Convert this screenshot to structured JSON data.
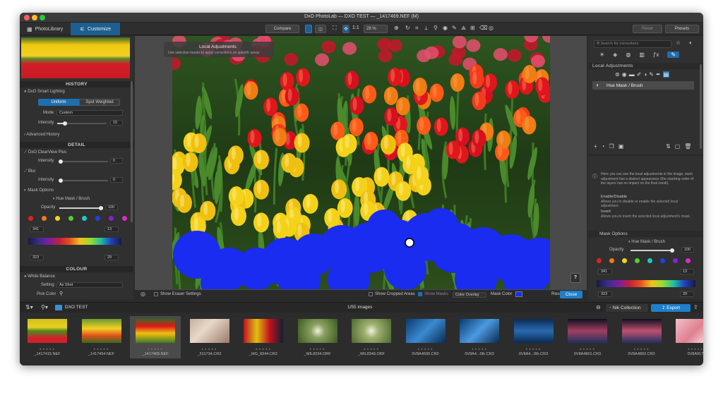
{
  "window": {
    "title": "DxO PhotoLab — DXO TEST — _1417469.NEF (M)"
  },
  "toolbar": {
    "tab_library": "PhotoLibrary",
    "tab_customize": "Customize",
    "compare_label": "Compare",
    "zoom_1to1": "1:1",
    "zoom_value": "28 %",
    "reset_label": "Reset",
    "presets_label": "Presets"
  },
  "left_panel": {
    "history_title": "HISTORY",
    "smart_lighting_label": "DxO Smart Lighting",
    "uniform_label": "Uniform",
    "spot_weighted_label": "Spot Weighted",
    "mode_label": "Mode",
    "mode_value": "Custom",
    "intensity_label": "Intensity",
    "intensity_value": "15",
    "advanced_history_label": "Advanced History",
    "detail_title": "DETAIL",
    "clearview_label": "DxO ClearView Plus",
    "clearview_intensity_label": "Intensity",
    "clearview_intensity_value": "0",
    "blur_label": "Blur",
    "blur_intensity_label": "Intensity",
    "blur_intensity_value": "0",
    "mask_options_label": "Mask Options",
    "hue_mask_label": "Hue Mask / Brush",
    "opacity_label": "Opacity",
    "opacity_value": "100",
    "hue_low": "341",
    "hue_high": "13",
    "hue_low2": "323",
    "hue_high2": "29",
    "colour_title": "COLOUR",
    "white_balance_label": "White Balance",
    "setting_label": "Setting",
    "setting_value": "As Shot",
    "pick_colour_label": "Pick Color"
  },
  "viewer": {
    "local_adjustments_banner": "Local Adjustments",
    "banner_hint": "Use selective masks to apply corrections on specific areas",
    "show_eraser_label": "Show Eraser Settings",
    "show_cropped_label": "Show Cropped Areas",
    "show_masks_label": "Show Masks",
    "color_overlay_value": "Color Overlay",
    "mask_color_label": "Mask Color",
    "reset_label": "Reset",
    "close_label": "Close",
    "help_label": "?"
  },
  "right_panel": {
    "search_placeholder": "Search for corrections",
    "local_adjustments_title": "Local Adjustments",
    "layer_name": "Hue Mask / Brush",
    "help_intro": "Here you can see the local adjustments in the image; each adjustment has a distinct appearance (the stacking order of the layers has no impact on the final result).",
    "enable_title": "Enable/Disable",
    "enable_text": "Allows you to disable or enable the selected local adjustment.",
    "invert_title": "Invert",
    "invert_text": "Allows you to invert the selected local adjustment's mask.",
    "mask_options_label": "Mask Options",
    "hue_mask_label": "Hue Mask / Brush",
    "opacity_label": "Opacity",
    "opacity_value": "100",
    "hue_low": "341",
    "hue_high": "13",
    "hue_low2": "323",
    "hue_high2": "29"
  },
  "filmstrip_bar": {
    "folder_name": "DXO TEST",
    "count_label": "1/55 images",
    "nik_label": "Nik Collection",
    "export_label": "Export"
  },
  "thumbnails": [
    {
      "name": "_1417415.NEF"
    },
    {
      "name": "_1417454.NEF"
    },
    {
      "name": "_1417469.NEF"
    },
    {
      "name": "_511734.CR3"
    },
    {
      "name": "_MG_8344.CR2"
    },
    {
      "name": "_WIL8334.ORF"
    },
    {
      "name": "_WIL8349.ORF"
    },
    {
      "name": "0V8A4590.CR3"
    },
    {
      "name": "0V8A4...0th.CR3"
    },
    {
      "name": "0V8A4...0th.CR3"
    },
    {
      "name": "0V8A4801.CR3"
    },
    {
      "name": "0V8A4802.CR3"
    },
    {
      "name": "0V8A917"
    }
  ],
  "colors": {
    "accent": "#1f7fc8",
    "mask_blue": "#1a2cf0",
    "panel_bg": "#303030"
  }
}
